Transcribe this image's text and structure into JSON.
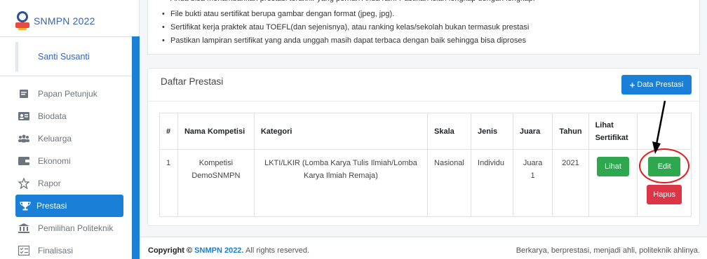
{
  "brand": {
    "title": "SNMPN 2022"
  },
  "user": {
    "name": "Santi Susanti"
  },
  "sidebar": {
    "items": [
      {
        "label": "Papan Petunjuk",
        "icon": "clipboard-icon"
      },
      {
        "label": "Biodata",
        "icon": "id-card-icon"
      },
      {
        "label": "Keluarga",
        "icon": "users-icon"
      },
      {
        "label": "Ekonomi",
        "icon": "wallet-icon"
      },
      {
        "label": "Rapor",
        "icon": "star-outline-icon"
      },
      {
        "label": "Prestasi",
        "icon": "trophy-icon"
      },
      {
        "label": "Pemilihan Politeknik",
        "icon": "institution-icon"
      },
      {
        "label": "Finalisasi",
        "icon": "checklist-icon"
      }
    ],
    "active": "Prestasi"
  },
  "notes": {
    "items": [
      "Anda bisa menambahkan prestasi terakhir yang pernah Anda raih. Pastikan isian lengkap dengan lengkap.",
      "File bukti atau sertifikat berupa gambar dengan format (jpeg, jpg).",
      "Sertifikat kerja praktek atau TOEFL(dan sejenisnya), atau ranking kelas/sekolah bukan termasuk prestasi",
      "Pastikan lampiran sertifikat yang anda unggah masih dapat terbaca dengan baik sehingga bisa diproses"
    ]
  },
  "card": {
    "title": "Daftar Prestasi",
    "add_label": "Data Prestasi"
  },
  "table": {
    "headers": [
      "#",
      "Nama Kompetisi",
      "Kategori",
      "Skala",
      "Jenis",
      "Juara",
      "Tahun",
      "Lihat Sertifikat",
      ""
    ],
    "rows": [
      {
        "no": "1",
        "nama": "Kompetisi DemoSNMPN",
        "kategori": "LKTI/LKIR (Lomba Karya Tulis Ilmiah/Lomba Karya Ilmiah Remaja)",
        "skala": "Nasional",
        "jenis": "Individu",
        "juara": "Juara 1",
        "tahun": "2021",
        "lihat": "Lihat",
        "edit": "Edit",
        "hapus": "Hapus"
      }
    ]
  },
  "footer": {
    "copyright_prefix": "Copyright ©",
    "copyright_brand": "SNMPN 2022.",
    "copyright_suffix": "All rights reserved.",
    "tagline": "Berkarya, berprestasi, menjadi ahli, politeknik ahlinya."
  },
  "colors": {
    "primary": "#1a7fd6",
    "success": "#2ea84f",
    "danger": "#dc3545",
    "annotation": "#e01b1b"
  }
}
